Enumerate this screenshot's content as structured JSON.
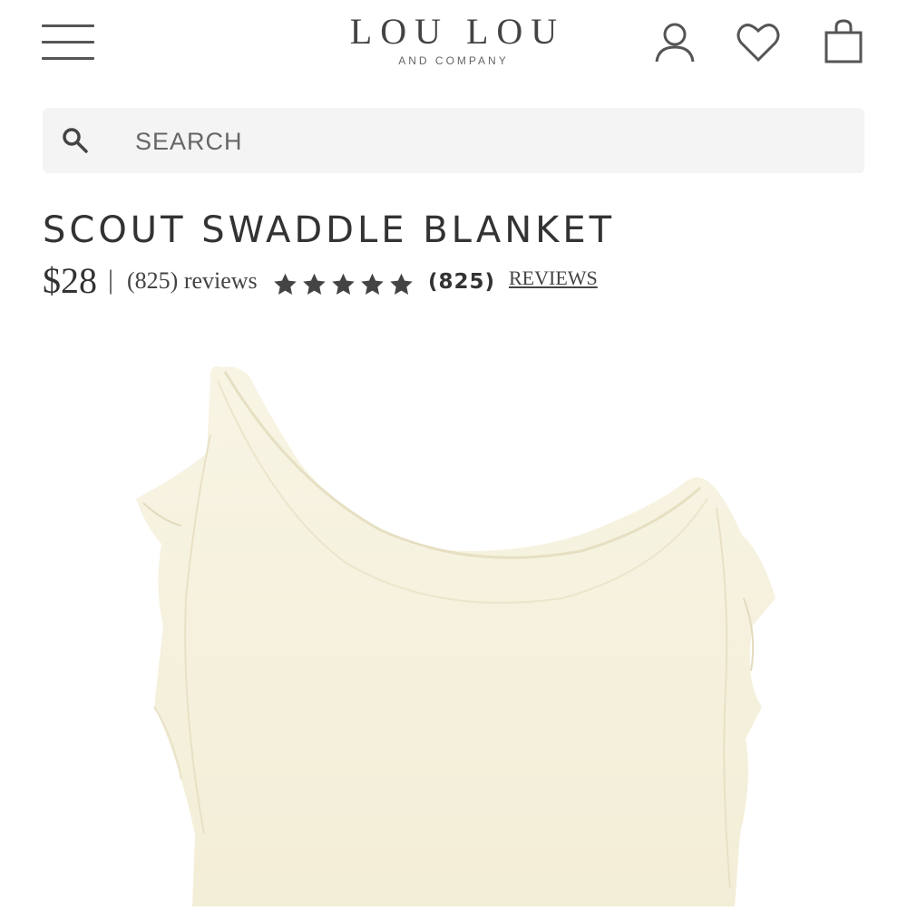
{
  "header": {
    "logo_main": "LOU LOU",
    "logo_sub": "AND COMPANY",
    "icons": [
      "menu-icon",
      "account-icon",
      "heart-icon",
      "cart-icon"
    ]
  },
  "search": {
    "placeholder": "SEARCH"
  },
  "product": {
    "title": "SCOUT SWADDLE BLANKET",
    "price": "$28",
    "separator": "|",
    "reviews_text": "(825) reviews",
    "rating_stars": 5,
    "review_count": "(825)",
    "reviews_link": "REVIEWS",
    "image_color": "#f5f0dc"
  },
  "colors": {
    "text": "#333333",
    "search_bg": "#f4f4f4",
    "star": "#444444"
  }
}
